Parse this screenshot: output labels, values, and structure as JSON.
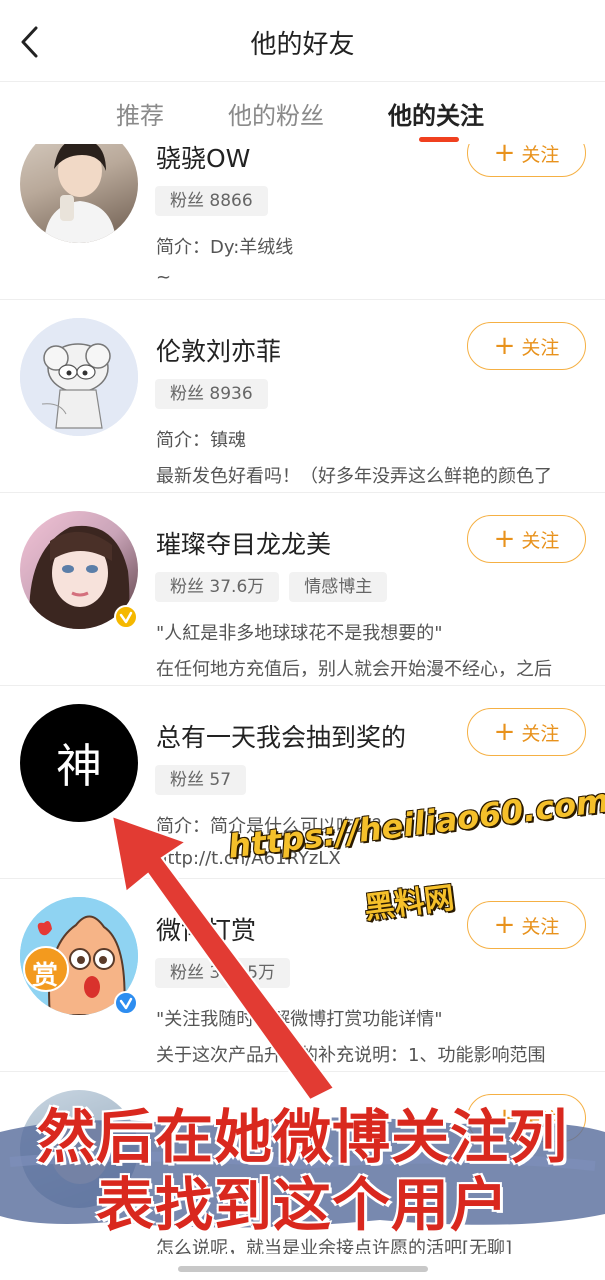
{
  "header": {
    "title": "他的好友",
    "back_icon": "chevron-left-icon"
  },
  "tabs": [
    {
      "label": "推荐",
      "active": false
    },
    {
      "label": "他的粉丝",
      "active": false
    },
    {
      "label": "他的关注",
      "active": true
    }
  ],
  "colors": {
    "accent": "#f0401f",
    "follow_border": "#f5b044",
    "follow_text": "#e8921c",
    "tag_bg": "#f2f2f2",
    "verified_badge_yellow": "#f5b800",
    "verified_badge_blue": "#2d8df0",
    "caption_red": "#d9281e",
    "watermark_yellow": "#f5c02a"
  },
  "follow_label": "关注",
  "users": [
    {
      "name": "骁骁OW",
      "tags": [
        "粉丝 8866"
      ],
      "line1": "简介：Dy:羊绒线",
      "line2": "~",
      "verified": "none",
      "avatar_icon": "photo-avatar-icon"
    },
    {
      "name": "伦敦刘亦菲",
      "tags": [
        "粉丝 8936"
      ],
      "line1": "简介：镇魂",
      "line2": "最新发色好看吗！（好多年没弄这么鲜艳的颜色了",
      "verified": "none",
      "avatar_icon": "cartoon-avatar-icon"
    },
    {
      "name": "璀璨夺目龙龙美",
      "tags": [
        "粉丝 37.6万",
        "情感博主"
      ],
      "line1": "\"人紅是非多地球球花不是我想要的\"",
      "line2": "在任何地方充值后，别人就会开始漫不经心，之后",
      "verified": "yellow",
      "avatar_icon": "photo-avatar-icon"
    },
    {
      "name": "总有一天我会抽到奖的",
      "tags": [
        "粉丝 57"
      ],
      "line1": "简介：简介是什么可以吃么？",
      "line2": "http://t.cn/A61RYzLX",
      "verified": "none",
      "avatar_text": "神",
      "avatar_icon": "text-avatar-icon"
    },
    {
      "name": "微博打赏",
      "tags": [
        "粉丝 362.5万"
      ],
      "line1": "\"关注我随时了解微博打赏功能详情\"",
      "line2": "关于这次产品升级的补充说明：1、功能影响范围",
      "verified": "blue",
      "avatar_text": "赏",
      "avatar_icon": "reward-mascot-icon"
    },
    {
      "name": "",
      "tags": [],
      "line1": "",
      "line2": "怎么说呢，就当是业余接点许愿的活吧[无聊]",
      "verified": "none",
      "avatar_icon": "photo-avatar-icon"
    }
  ],
  "overlay": {
    "watermark_url": "https://heiliao60.com",
    "watermark_name": "黑料网",
    "caption_line1": "然后在她微博关注列",
    "caption_line2": "表找到这个用户",
    "arrow_icon": "red-arrow-icon"
  }
}
